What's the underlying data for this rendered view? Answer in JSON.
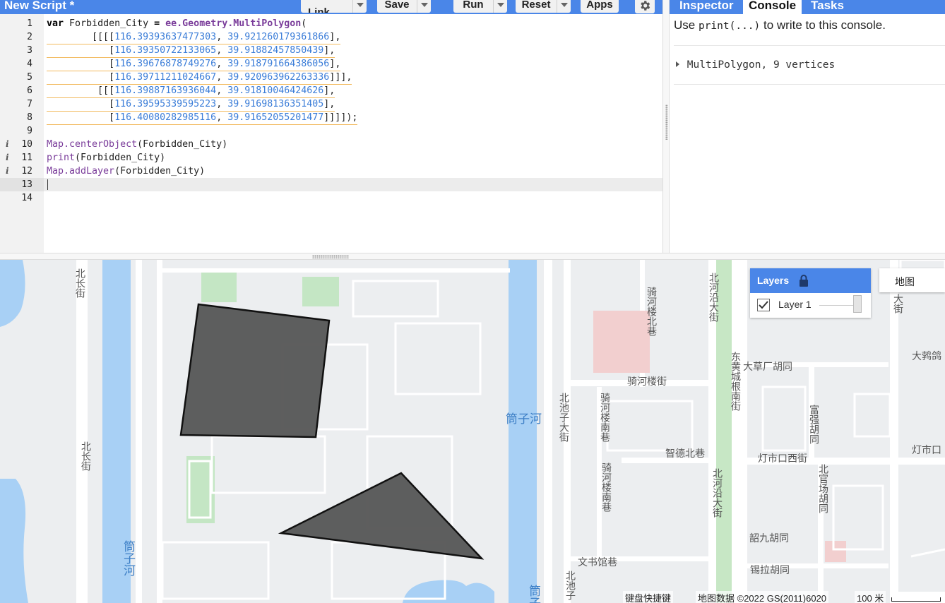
{
  "header": {
    "title": "New Script *",
    "buttons": [
      {
        "label": "Get Link"
      },
      {
        "label": "Save"
      },
      {
        "label": "Run"
      },
      {
        "label": "Reset"
      },
      {
        "label": "Apps"
      }
    ]
  },
  "editor": {
    "line_numbers": [
      "1",
      "2",
      "3",
      "4",
      "5",
      "6",
      "7",
      "8",
      "9",
      "10",
      "11",
      "12",
      "13",
      "14"
    ],
    "info_marker": "i",
    "code": {
      "l1": {
        "kw": "var",
        "name": " Forbidden_City ",
        "eq": "=",
        "space": " ",
        "fn": "ee.Geometry.MultiPolygon",
        "paren": "("
      },
      "l2": {
        "pre": "        [[[[",
        "a": "116.39393637477303",
        "sep": ", ",
        "b": "39.921260179361866",
        "post": "],"
      },
      "l3": {
        "pre": "           [",
        "a": "116.39350722133065",
        "sep": ", ",
        "b": "39.91882457850439",
        "post": "],"
      },
      "l4": {
        "pre": "           [",
        "a": "116.39676878749276",
        "sep": ", ",
        "b": "39.918791664386056",
        "post": "],"
      },
      "l5": {
        "pre": "           [",
        "a": "116.39711211024667",
        "sep": ", ",
        "b": "39.920963962263336",
        "post": "]]],"
      },
      "l6": {
        "pre": "         [[[",
        "a": "116.39887163936044",
        "sep": ", ",
        "b": "39.91810046424626",
        "post": "],"
      },
      "l7": {
        "pre": "           [",
        "a": "116.39595339595223",
        "sep": ", ",
        "b": "39.91698136351405",
        "post": "],"
      },
      "l8": {
        "pre": "           [",
        "a": "116.40080282985116",
        "sep": ", ",
        "b": "39.91652055201477",
        "post": "]]]]);"
      },
      "l10": {
        "fn": "Map.centerObject",
        "rest": "(Forbidden_City)"
      },
      "l11": {
        "fn": "print",
        "rest": "(Forbidden_City)"
      },
      "l12": {
        "fn": "Map.addLayer",
        "rest": "(Forbidden_City)"
      }
    }
  },
  "right_panel": {
    "tabs": [
      {
        "label": "Inspector"
      },
      {
        "label": "Console",
        "active": true
      },
      {
        "label": "Tasks"
      }
    ],
    "console": {
      "hint_prefix": "Use ",
      "hint_code": "print(...)",
      "hint_suffix": " to write to this console.",
      "output": "MultiPolygon, 9 vertices"
    }
  },
  "map": {
    "labels": {
      "beichangjie_1": "北长街",
      "beichangjie_2": "北长街",
      "tongzihe_1": "筒子河",
      "tongzihe_2": "筒子河",
      "tongzihe_3": "筒子",
      "qiheloubeixiang": "骑河楼北巷",
      "qihelou_jie": "骑河楼街",
      "qihelou_nanxiang_1": "骑河楼南巷",
      "qihelou_nanxiang_2": "骑河楼南巷",
      "beichizi_dajie": "北池子大街",
      "beichizi": "北池子",
      "zhide_beixiang": "智德北巷",
      "wenshuguan_xiang": "文书馆巷",
      "beiheyan_1": "北河沿大街",
      "beiheyan_2": "北河沿大街",
      "dongcheng": "东黄城根南街",
      "dacaochang": "大草厂胡同",
      "fuqiang": "富强胡同",
      "dengshikou_xi": "灯市口西街",
      "dengshikou": "灯市口",
      "beiguanchang": "北官场胡同",
      "shaojiu": "韶九胡同",
      "xila": "锡拉胡同",
      "dajue": "大鹁鸽",
      "edge_dajie": "大街"
    },
    "layers_panel": {
      "title": "Layers",
      "layer_name": "Layer 1",
      "checked": true,
      "opacity": 1.0
    },
    "map_type_button": "地图",
    "attribution": {
      "shortcuts": "键盘快捷键",
      "data": "地图数据 ©2022 GS(2011)6020",
      "scale": "100 米"
    },
    "colors": {
      "polygon_fill": "#555555",
      "polygon_stroke": "#111111",
      "water": "#a8d0f5",
      "park": "#c4e6c4"
    }
  }
}
